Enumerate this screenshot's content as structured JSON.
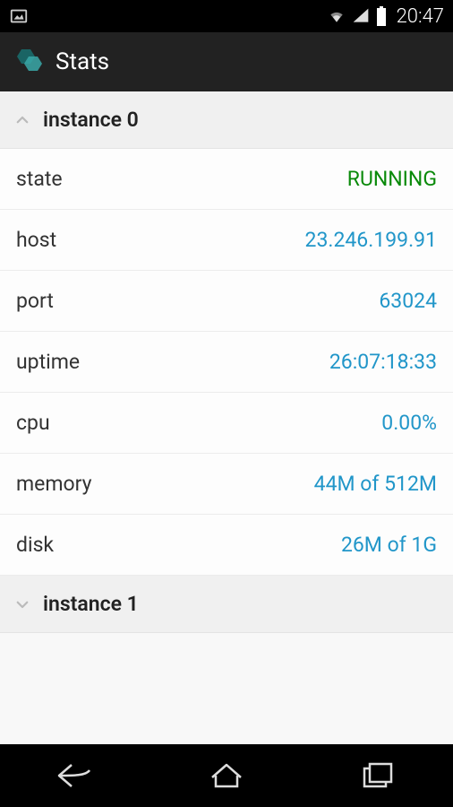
{
  "statusBar": {
    "time": "20:47"
  },
  "actionBar": {
    "title": "Stats"
  },
  "sections": [
    {
      "title": "instance 0",
      "expanded": true,
      "rows": [
        {
          "label": "state",
          "value": "RUNNING",
          "color": "green"
        },
        {
          "label": "host",
          "value": "23.246.199.91",
          "color": "blue"
        },
        {
          "label": "port",
          "value": "63024",
          "color": "blue"
        },
        {
          "label": "uptime",
          "value": "26:07:18:33",
          "color": "blue"
        },
        {
          "label": "cpu",
          "value": "0.00%",
          "color": "blue"
        },
        {
          "label": "memory",
          "value": "44M of 512M",
          "color": "blue"
        },
        {
          "label": "disk",
          "value": "26M of 1G",
          "color": "blue"
        }
      ]
    },
    {
      "title": "instance 1",
      "expanded": false,
      "rows": []
    }
  ]
}
